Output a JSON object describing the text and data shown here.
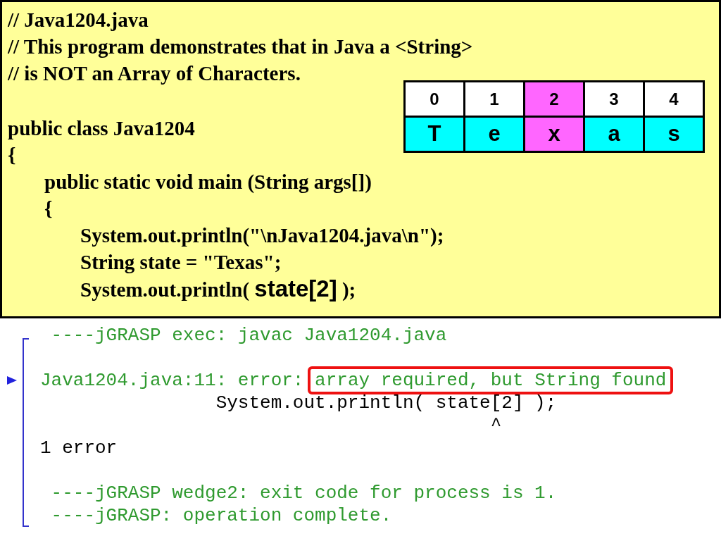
{
  "comments": [
    "// Java1204.java",
    "// This program demonstrates that in Java a <String>",
    "// is NOT an Array of Characters."
  ],
  "code": [
    {
      "text": "public class Java1204"
    },
    {
      "text": "{",
      "children": [
        {
          "text": "public static void main (String args[])"
        },
        {
          "text": "{",
          "children": [
            {
              "text": "System.out.println(\"\\nJava1204.java\\n\");"
            },
            {
              "text": "String state = \"Texas\";"
            },
            {
              "parts": [
                {
                  "kind": "plain",
                  "text": "System.out.println( "
                },
                {
                  "kind": "expression",
                  "text": "state[2]"
                },
                {
                  "kind": "plain",
                  "text": " );"
                }
              ]
            }
          ]
        }
      ]
    }
  ],
  "array": [
    {
      "index": "0",
      "letter": "T",
      "selected": false
    },
    {
      "index": "1",
      "letter": "e",
      "selected": false
    },
    {
      "index": "2",
      "letter": "x",
      "selected": true
    },
    {
      "index": "3",
      "letter": "a",
      "selected": false
    },
    {
      "index": "4",
      "letter": "s",
      "selected": false
    }
  ],
  "output": [
    {
      "lines": [
        {
          "kind": "exec",
          "text": "----jGRASP exec: javac Java1204.java",
          "marked": false
        }
      ]
    },
    {
      "lines": [
        {
          "kind": "error",
          "text": "Java1204.java:11: error: ",
          "highlight": "array required, but String found",
          "marked": true
        },
        {
          "kind": "source",
          "text": "System.out.println( state[2] );",
          "marked": false
        },
        {
          "kind": "caret",
          "text": "^",
          "marked": false
        },
        {
          "kind": "count",
          "text": "1 error",
          "marked": false
        }
      ]
    },
    {
      "lines": [
        {
          "kind": "exec",
          "text": "----jGRASP wedge2: exit code for process is 1.",
          "marked": false
        },
        {
          "kind": "exec",
          "text": "----jGRASP: operation complete.",
          "marked": false
        }
      ]
    }
  ]
}
